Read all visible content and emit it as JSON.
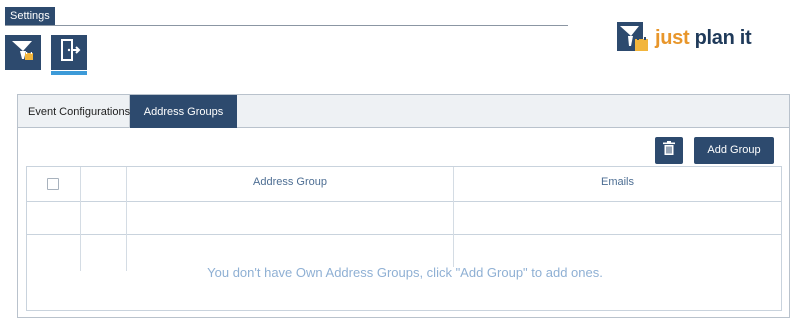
{
  "header": {
    "settings_label": "Settings"
  },
  "toolbar": {
    "icons": [
      "filter-calendar-icon",
      "exit-door-icon"
    ]
  },
  "logo": {
    "word1": "just ",
    "word2": "plan it"
  },
  "tabs": [
    {
      "label": "Event Configurations",
      "active": false
    },
    {
      "label": "Address Groups",
      "active": true
    }
  ],
  "actions": {
    "delete_icon": "trash-icon",
    "add_group_label": "Add Group"
  },
  "table": {
    "columns": [
      "Address Group",
      "Emails"
    ],
    "empty_message": "You don't have Own Address Groups, click \"Add Group\" to add ones."
  },
  "colors": {
    "primary": "#2d4a6e",
    "accent": "#e8962b",
    "underline": "#3c9ad8"
  }
}
